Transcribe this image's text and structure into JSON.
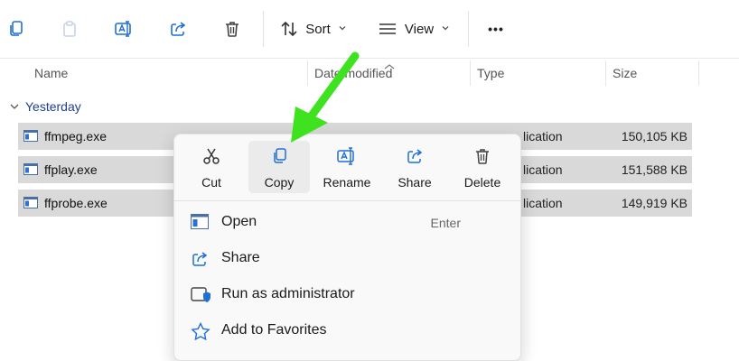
{
  "toolbar": {
    "buttons": [
      {
        "name": "copy-path",
        "icon": "copy-icon"
      },
      {
        "name": "paste",
        "icon": "paste-icon"
      },
      {
        "name": "rename",
        "icon": "rename-icon"
      },
      {
        "name": "share",
        "icon": "share-icon"
      },
      {
        "name": "delete",
        "icon": "trash-icon"
      }
    ],
    "sort_label": "Sort",
    "view_label": "View",
    "more_label": "•••"
  },
  "columns": {
    "name": "Name",
    "date": "Date modified",
    "type": "Type",
    "size": "Size"
  },
  "group": {
    "label": "Yesterday"
  },
  "files": [
    {
      "name": "ffmpeg.exe",
      "date": "",
      "type": "Application",
      "size": "150,105 KB"
    },
    {
      "name": "ffplay.exe",
      "date": "",
      "type": "Application",
      "size": "151,588 KB"
    },
    {
      "name": "ffprobe.exe",
      "date": "",
      "type": "Application",
      "size": "149,919 KB"
    }
  ],
  "visible_type_fragment": "lication",
  "visible_date_fragment": "",
  "context_menu": {
    "quick_actions": [
      {
        "label": "Cut",
        "icon": "scissors-icon"
      },
      {
        "label": "Copy",
        "icon": "copy-icon",
        "active": true
      },
      {
        "label": "Rename",
        "icon": "rename-icon"
      },
      {
        "label": "Share",
        "icon": "share-icon"
      },
      {
        "label": "Delete",
        "icon": "trash-icon"
      }
    ],
    "items": [
      {
        "label": "Open",
        "shortcut": "Enter",
        "icon": "app-window-icon"
      },
      {
        "label": "Share",
        "shortcut": "",
        "icon": "share-icon"
      },
      {
        "label": "Run as administrator",
        "shortcut": "",
        "icon": "shield-window-icon"
      },
      {
        "label": "Add to Favorites",
        "shortcut": "",
        "icon": "star-icon"
      }
    ]
  },
  "colors": {
    "accent": "#0f6cbd",
    "row_selected": "#d9d9d9",
    "annotation_arrow": "#3fe21f",
    "group_text": "#1f3f8f"
  }
}
